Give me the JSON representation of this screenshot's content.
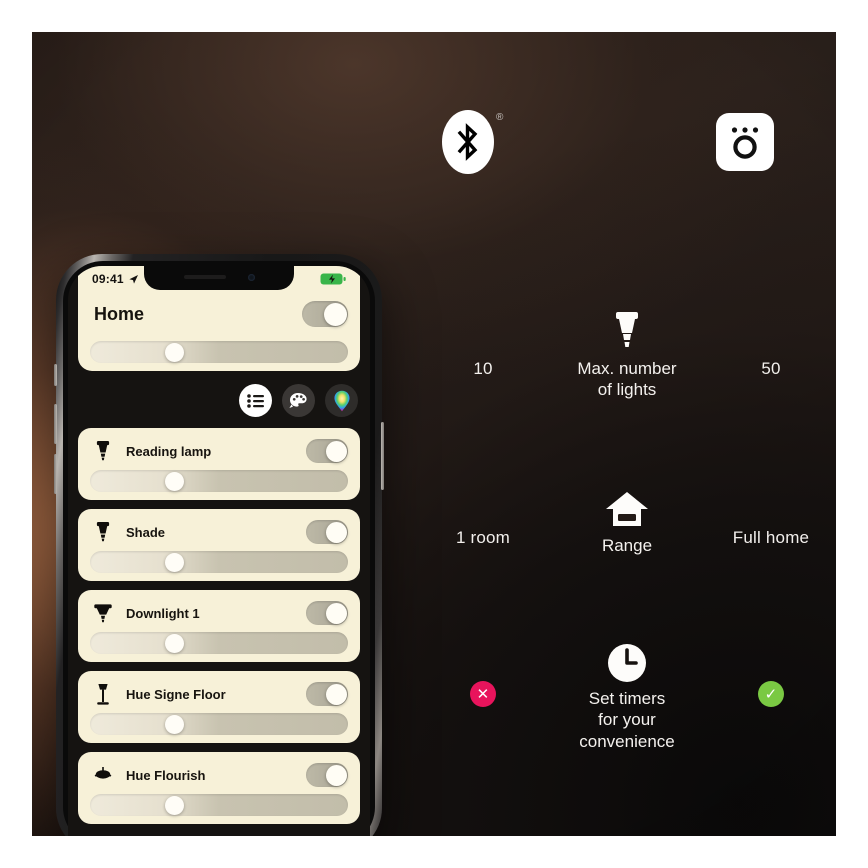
{
  "comparison": {
    "header": {
      "left_icon": "bluetooth-icon",
      "left_trademark": "®",
      "right_icon": "hue-bridge-icon"
    },
    "rows": [
      {
        "id": "max-lights",
        "left_value": "10",
        "label": "Max. number\nof lights",
        "label_line1": "Max. number",
        "label_line2": "of lights",
        "icon": "bulb-icon",
        "right_value": "50"
      },
      {
        "id": "range",
        "left_value": "1 room",
        "label": "Range",
        "icon": "home-icon",
        "right_value": "Full home"
      },
      {
        "id": "timers",
        "left_value": "✕",
        "label_line1": "Set timers",
        "label_line2": "for your",
        "label_line3": "convenience",
        "icon": "clock-icon",
        "right_value": "✓",
        "left_color": "#e8145c",
        "right_color": "#7ac943"
      }
    ]
  },
  "phone": {
    "status_bar": {
      "time": "09:41",
      "location_icon": "location-arrow-icon",
      "battery_icon": "battery-charging-icon"
    },
    "header": {
      "title": "Home",
      "master_toggle": "on",
      "brightness_percent": 34
    },
    "mode_buttons": [
      {
        "name": "list-view",
        "icon": "list-icon",
        "state": "active"
      },
      {
        "name": "scenes-palette",
        "icon": "palette-icon",
        "state": "inactive"
      },
      {
        "name": "color-picker",
        "icon": "color-drop-icon",
        "state": "inactive"
      }
    ],
    "lights": [
      {
        "name": "Reading lamp",
        "icon": "spot-bulb-icon",
        "toggle": "on",
        "brightness_percent": 34
      },
      {
        "name": "Shade",
        "icon": "spot-bulb-icon",
        "toggle": "on",
        "brightness_percent": 34
      },
      {
        "name": "Downlight 1",
        "icon": "downlight-icon",
        "toggle": "on",
        "brightness_percent": 34
      },
      {
        "name": "Hue Signe Floor",
        "icon": "floor-lamp-icon",
        "toggle": "on",
        "brightness_percent": 34
      },
      {
        "name": "Hue Flourish",
        "icon": "pendant-lamp-icon",
        "toggle": "on",
        "brightness_percent": 34
      }
    ]
  },
  "colors": {
    "card_bg": "#f7f1d8",
    "accent_warm": "#b9764c",
    "negative": "#e8145c",
    "positive": "#7ac943",
    "text_light": "#f4f1ee",
    "text_dark": "#17140f"
  }
}
